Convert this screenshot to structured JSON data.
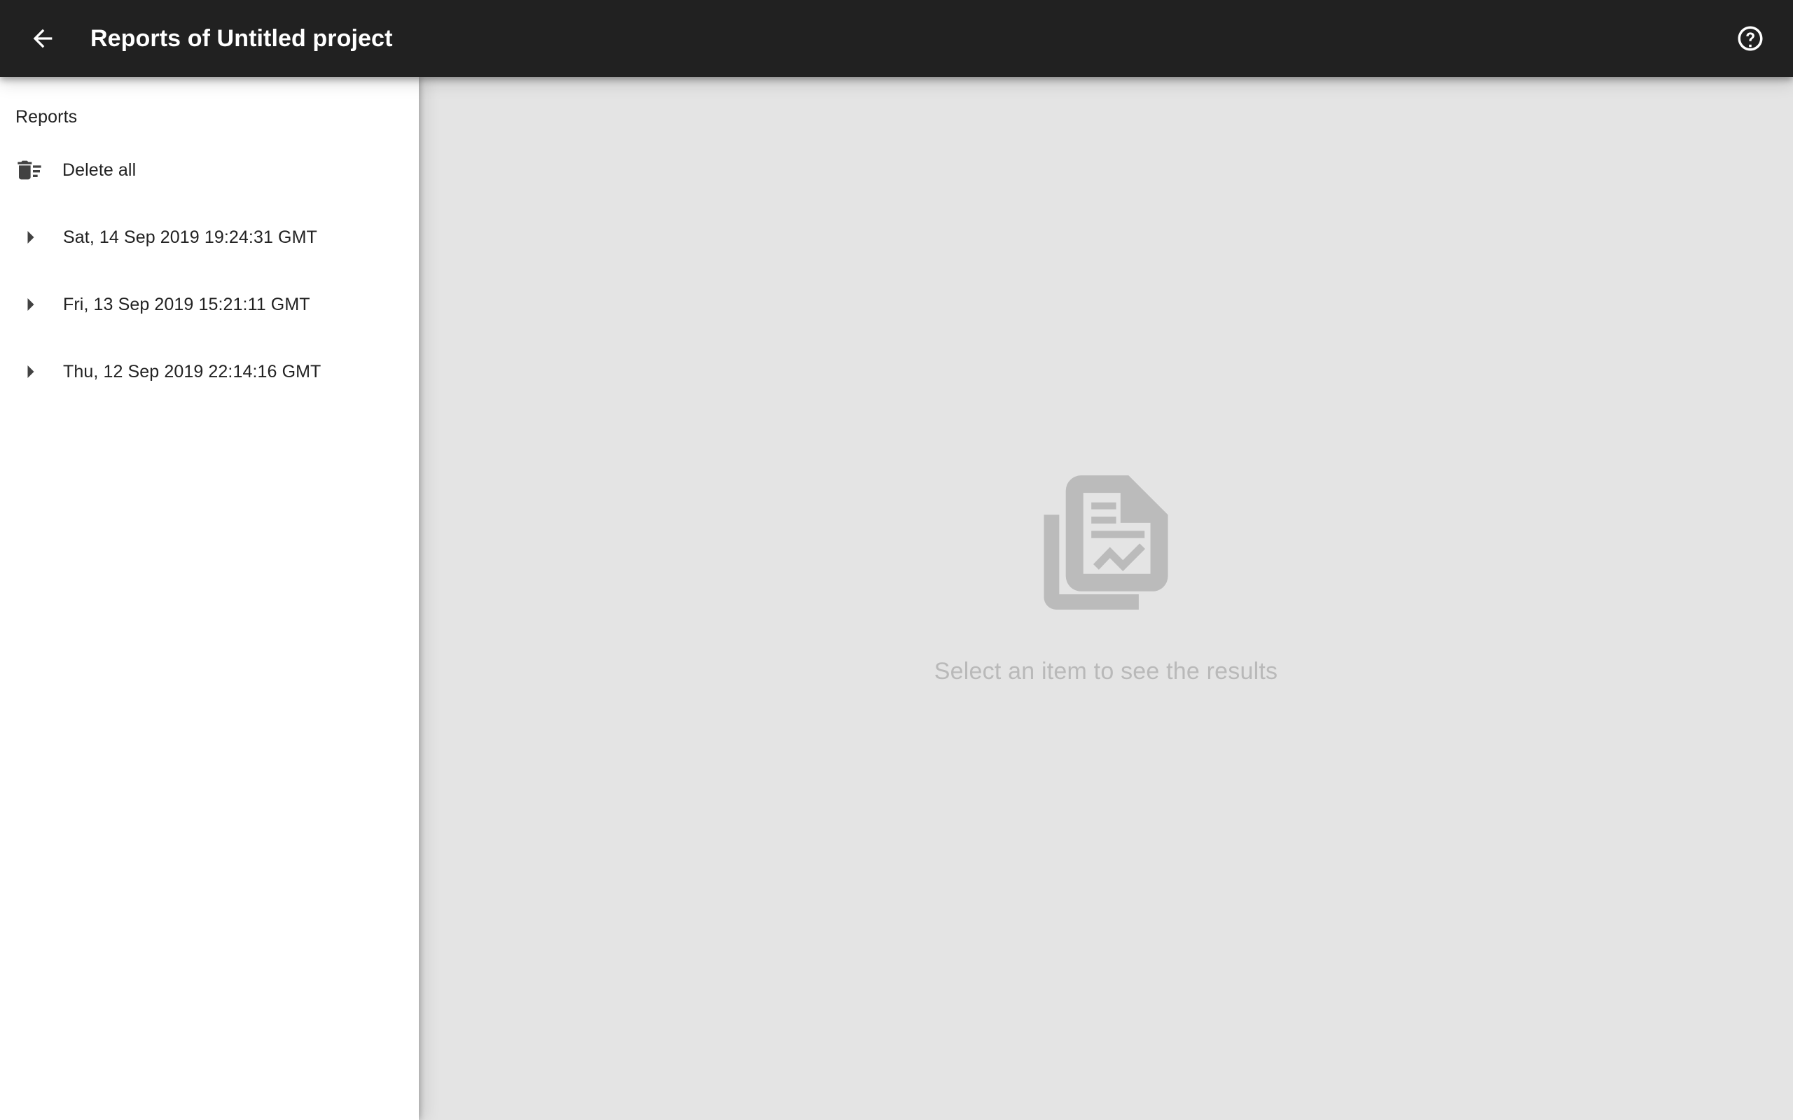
{
  "header": {
    "back_icon": "arrow-back-icon",
    "title": "Reports of Untitled project",
    "help_icon": "help-circle-icon",
    "background_color": "#212121",
    "text_color": "#ffffff"
  },
  "sidebar": {
    "heading": "Reports",
    "background_color": "#ffffff",
    "action": {
      "icon": "delete-sweep-icon",
      "label": "Delete all"
    },
    "items": [
      {
        "caret_icon": "caret-right-icon",
        "label": "Sat, 14 Sep 2019 19:24:31 GMT",
        "expanded": false
      },
      {
        "caret_icon": "caret-right-icon",
        "label": "Fri, 13 Sep 2019 15:21:11 GMT",
        "expanded": false
      },
      {
        "caret_icon": "caret-right-icon",
        "label": "Thu, 12 Sep 2019 22:14:16 GMT",
        "expanded": false
      }
    ]
  },
  "main": {
    "background_color": "#e4e4e4",
    "empty_state": {
      "icon": "document-report-stack-icon",
      "icon_color": "#bbbbbb",
      "message": "Select an item to see the results",
      "message_color": "#b9b9b9"
    }
  }
}
